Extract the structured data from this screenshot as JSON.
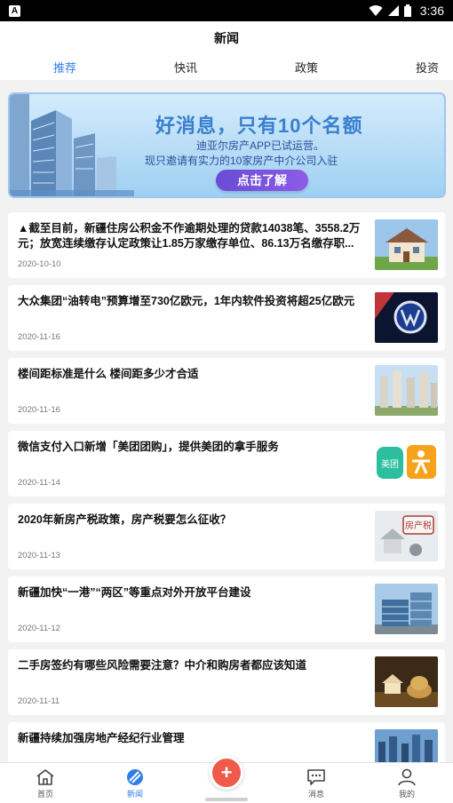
{
  "status_bar": {
    "time": "3:36",
    "app_badge": "A"
  },
  "header": {
    "title": "新闻"
  },
  "tabs": [
    {
      "label": "推荐",
      "active": true
    },
    {
      "label": "快讯",
      "active": false
    },
    {
      "label": "政策",
      "active": false
    },
    {
      "label": "投资",
      "active": false
    }
  ],
  "banner": {
    "headline": "好消息，只有10个名额",
    "line1": "迪亚尔房产APP已试运营。",
    "line2": "现只邀请有实力的10家房产中介公司入驻",
    "button": "点击了解"
  },
  "news": [
    {
      "title": "▲截至目前，新疆住房公积金不作逾期处理的贷款14038笔、3558.2万元；放宽连续缴存认定政策让1.85万家缴存单位、86.13万名缴存职...",
      "date": "2020-10-10",
      "thumb": "house"
    },
    {
      "title": "大众集团“油转电”预算增至730亿欧元，1年内软件投资将超25亿欧元",
      "date": "2020-11-16",
      "thumb": "vw-logo"
    },
    {
      "title": "楼间距标准是什么 楼间距多少才合适",
      "date": "2020-11-16",
      "thumb": "towers"
    },
    {
      "title": "微信支付入口新增「美团团购」，提供美团的拿手服务",
      "date": "2020-11-14",
      "thumb": "meituan"
    },
    {
      "title": "2020年新房产税政策，房产税要怎么征收？",
      "date": "2020-11-13",
      "thumb": "tax"
    },
    {
      "title": "新疆加快“一港”“两区”等重点对外开放平台建设",
      "date": "2020-11-12",
      "thumb": "office"
    },
    {
      "title": "二手房签约有哪些风险需要注意？中介和购房者都应该知道",
      "date": "2020-11-11",
      "thumb": "money-house"
    },
    {
      "title": "新疆持续加强房地产经纪行业管理",
      "date": "",
      "thumb": "city"
    }
  ],
  "bottom_nav": [
    {
      "label": "首页",
      "icon": "home-icon",
      "active": false
    },
    {
      "label": "新闻",
      "icon": "news-icon",
      "active": true
    },
    {
      "label": "消息",
      "icon": "message-icon",
      "active": false
    },
    {
      "label": "我的",
      "icon": "user-icon",
      "active": false
    }
  ],
  "fab": {
    "symbol": "+"
  },
  "colors": {
    "accent": "#2f7ee8",
    "fab": "#f05a4a",
    "banner_button": "#7a52de"
  }
}
